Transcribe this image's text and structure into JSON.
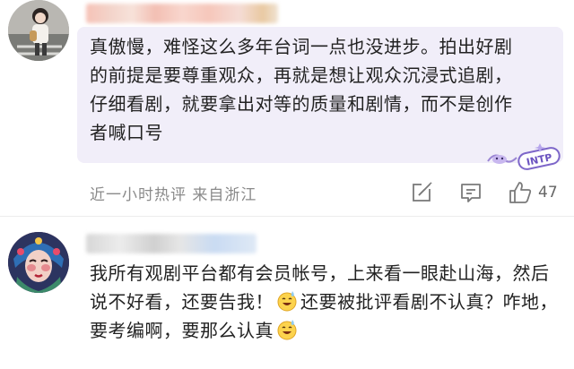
{
  "comments": [
    {
      "text": "真傲慢，难怪这么多年台词一点也没进步。拍出好剧的前提是要尊重观众，再就是想让观众沉浸式追剧，仔细看剧，就要拿出对等的质量和剧情，而不是创作者喊口号",
      "meta": "近一小时热评  来自浙江",
      "likes": "47",
      "sticker_icon": "intp-sticker-icon"
    },
    {
      "text_part1": "我所有观剧平台都有会员帐号，上来看一眼赴山海，然后说不好看，还要告我！",
      "text_part2": "还要被批评看剧不认真？咋地，要考编啊，要那么认真",
      "emoji_icon": "sweat-smile-emoji-icon"
    }
  ],
  "colors": {
    "bubble": "#f1eef9",
    "meta": "#8a8a8a",
    "icon": "#7a7a7a"
  }
}
